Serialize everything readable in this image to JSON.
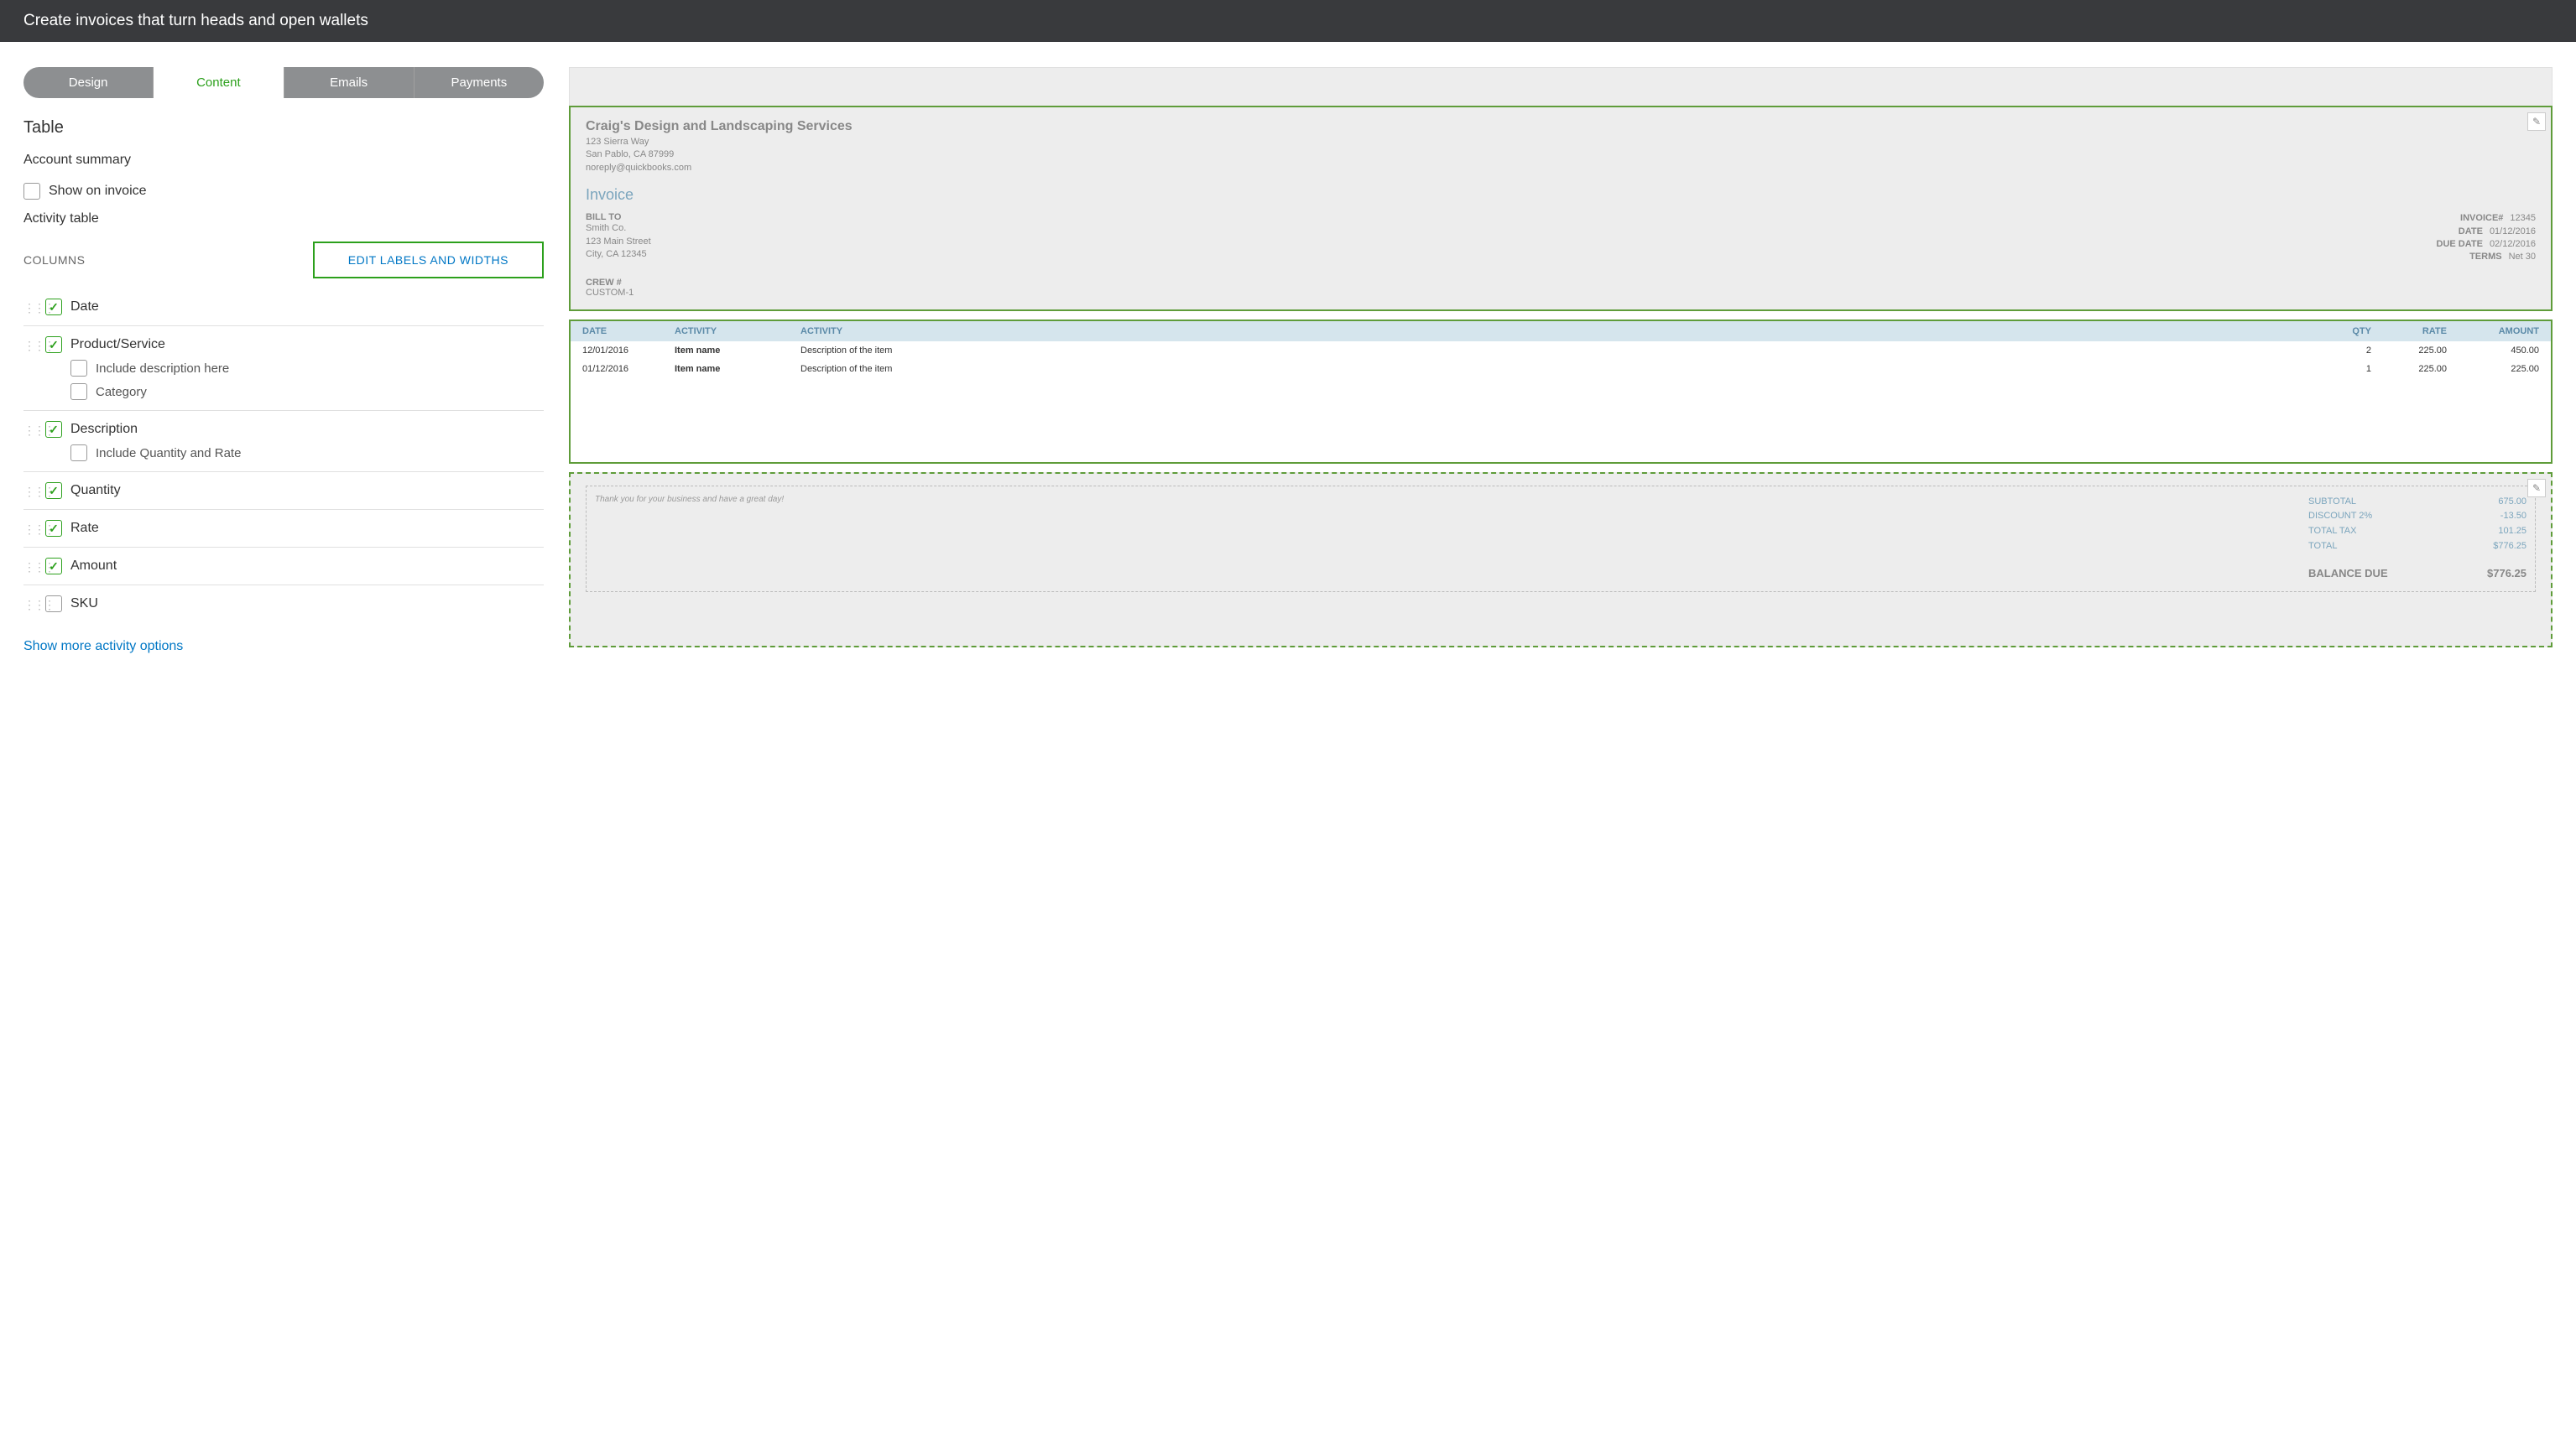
{
  "header": {
    "title": "Create invoices that turn heads and open wallets"
  },
  "tabs": {
    "design": "Design",
    "content": "Content",
    "emails": "Emails",
    "payments": "Payments"
  },
  "left": {
    "table_title": "Table",
    "account_summary": "Account summary",
    "show_on_invoice": "Show on invoice",
    "activity_table": "Activity table",
    "columns_label": "COLUMNS",
    "edit_labels_btn": "EDIT LABELS AND WIDTHS",
    "cols": {
      "date": "Date",
      "product_service": "Product/Service",
      "include_desc_here": "Include description here",
      "category": "Category",
      "description": "Description",
      "include_qty_rate": "Include Quantity and Rate",
      "quantity": "Quantity",
      "rate": "Rate",
      "amount": "Amount",
      "sku": "SKU"
    },
    "show_more": "Show more activity options"
  },
  "preview": {
    "company": {
      "name": "Craig's Design and Landscaping Services",
      "addr1": "123 Sierra Way",
      "addr2": "San Pablo, CA 87999",
      "email": "noreply@quickbooks.com"
    },
    "invoice_title": "Invoice",
    "bill_to": {
      "label": "BILL TO",
      "name": "Smith Co.",
      "addr1": "123 Main Street",
      "addr2": "City, CA 12345"
    },
    "meta": {
      "invoice_num_label": "INVOICE#",
      "invoice_num": "12345",
      "date_label": "DATE",
      "date": "01/12/2016",
      "due_date_label": "DUE DATE",
      "due_date": "02/12/2016",
      "terms_label": "TERMS",
      "terms": "Net 30"
    },
    "crew": {
      "label": "CREW #",
      "value": "CUSTOM-1"
    },
    "table": {
      "headers": {
        "date": "DATE",
        "activity1": "ACTIVITY",
        "activity2": "ACTIVITY",
        "qty": "QTY",
        "rate": "RATE",
        "amount": "AMOUNT"
      },
      "rows": [
        {
          "date": "12/01/2016",
          "item": "Item name",
          "desc": "Description of the item",
          "qty": "2",
          "rate": "225.00",
          "amount": "450.00"
        },
        {
          "date": "01/12/2016",
          "item": "Item name",
          "desc": "Description of the item",
          "qty": "1",
          "rate": "225.00",
          "amount": "225.00"
        }
      ]
    },
    "footer": {
      "thank_you": "Thank you for your business and have a great day!",
      "subtotal_label": "SUBTOTAL",
      "subtotal": "675.00",
      "discount_label": "DISCOUNT 2%",
      "discount": "-13.50",
      "tax_label": "TOTAL TAX",
      "tax": "101.25",
      "total_label": "TOTAL",
      "total": "$776.25",
      "balance_label": "BALANCE DUE",
      "balance": "$776.25"
    }
  }
}
